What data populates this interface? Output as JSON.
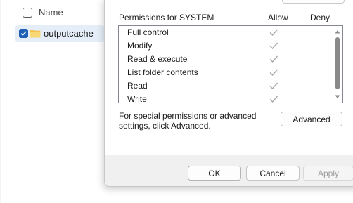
{
  "explorer": {
    "header": {
      "name_label": "Name"
    },
    "files": [
      {
        "name": "outputcache",
        "checked": true,
        "selected": true,
        "icon": "folder-icon"
      }
    ]
  },
  "dialog": {
    "permissions_title": "Permissions for SYSTEM",
    "columns": {
      "allow": "Allow",
      "deny": "Deny"
    },
    "permissions": [
      {
        "label": "Full control",
        "allow": true,
        "deny": false
      },
      {
        "label": "Modify",
        "allow": true,
        "deny": false
      },
      {
        "label": "Read & execute",
        "allow": true,
        "deny": false
      },
      {
        "label": "List folder contents",
        "allow": true,
        "deny": false
      },
      {
        "label": "Read",
        "allow": true,
        "deny": false
      },
      {
        "label": "Write",
        "allow": true,
        "deny": false
      }
    ],
    "advanced_text": "For special permissions or advanced settings, click Advanced.",
    "buttons": {
      "advanced": "Advanced",
      "ok": "OK",
      "cancel": "Cancel",
      "apply": "Apply"
    }
  },
  "colors": {
    "accent": "#1f5fb3",
    "selection": "#e5eef8",
    "folder": "#f3c24f",
    "check_disabled": "#a6a6a6"
  }
}
